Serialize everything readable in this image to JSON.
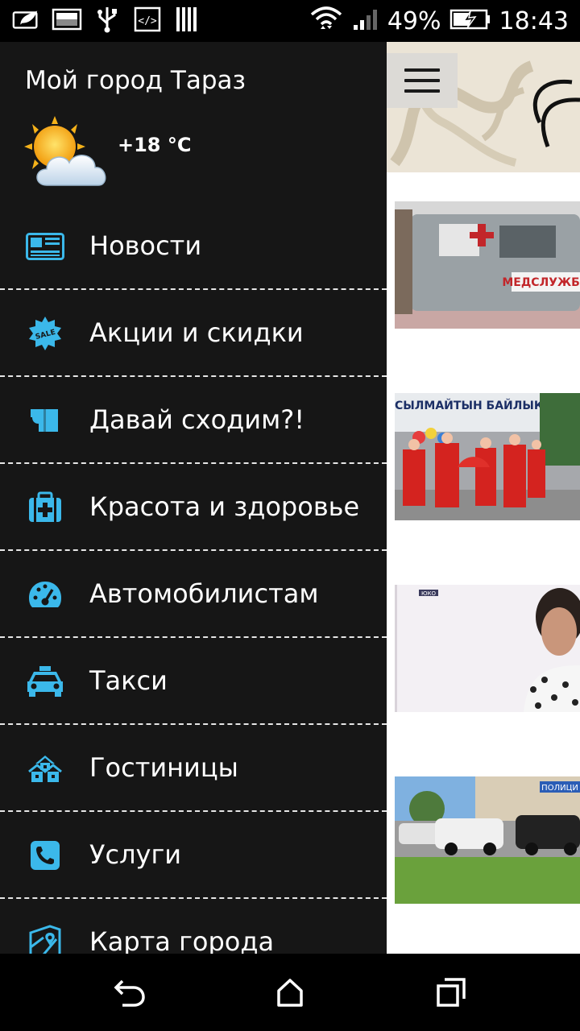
{
  "status_bar": {
    "battery_percent": "49%",
    "time": "18:43",
    "left_icons": [
      "leaf-battery-saver-icon",
      "image-icon",
      "usb-icon",
      "code-icon",
      "barcode-icon"
    ],
    "right_icons": [
      "wifi-icon",
      "signal-icon",
      "battery-charging-icon"
    ]
  },
  "drawer": {
    "title": "Мой город Тараз",
    "weather": {
      "temperature": "+18 °C",
      "icon": "partly-cloudy-sun-icon"
    },
    "items": [
      {
        "label": "Новости",
        "icon": "newspaper-icon"
      },
      {
        "label": "Акции и скидки",
        "icon": "sale-badge-icon"
      },
      {
        "label": "Давай сходим?!",
        "icon": "ticket-icon"
      },
      {
        "label": "Красота и здоровье",
        "icon": "first-aid-kit-icon"
      },
      {
        "label": "Автомобилистам",
        "icon": "speedometer-icon"
      },
      {
        "label": "Такси",
        "icon": "taxi-icon"
      },
      {
        "label": "Гостиницы",
        "icon": "hotel-icon"
      },
      {
        "label": "Услуги",
        "icon": "phone-icon"
      },
      {
        "label": "Карта города",
        "icon": "map-icon"
      }
    ]
  },
  "content": {
    "menu_button_icon": "hamburger-icon",
    "thumbnails": [
      "news-thumb-ambulance",
      "news-thumb-dancers",
      "news-thumb-woman",
      "news-thumb-cars"
    ]
  },
  "colors": {
    "drawer_bg": "#161616",
    "icon_accent": "#3bb8ea",
    "divider": "#e6e6e6"
  },
  "nav_bar": [
    "back-icon",
    "home-icon",
    "recents-icon"
  ]
}
